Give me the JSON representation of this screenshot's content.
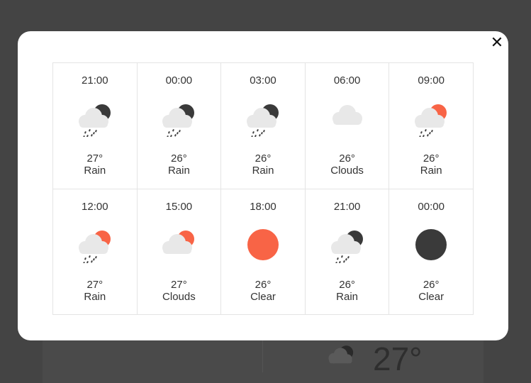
{
  "modal": {
    "close_label": "✕"
  },
  "background": {
    "temperature": "27°",
    "icon": "rain-night-icon"
  },
  "forecast": [
    {
      "time": "21:00",
      "temp": "27°",
      "condition": "Rain",
      "icon": "rain-night"
    },
    {
      "time": "00:00",
      "temp": "26°",
      "condition": "Rain",
      "icon": "rain-night"
    },
    {
      "time": "03:00",
      "temp": "26°",
      "condition": "Rain",
      "icon": "rain-night"
    },
    {
      "time": "06:00",
      "temp": "26°",
      "condition": "Clouds",
      "icon": "clouds"
    },
    {
      "time": "09:00",
      "temp": "26°",
      "condition": "Rain",
      "icon": "rain-day"
    },
    {
      "time": "12:00",
      "temp": "27°",
      "condition": "Rain",
      "icon": "rain-day"
    },
    {
      "time": "15:00",
      "temp": "27°",
      "condition": "Clouds",
      "icon": "clouds-day"
    },
    {
      "time": "18:00",
      "temp": "26°",
      "condition": "Clear",
      "icon": "clear-day"
    },
    {
      "time": "21:00",
      "temp": "26°",
      "condition": "Rain",
      "icon": "rain-night"
    },
    {
      "time": "00:00",
      "temp": "26°",
      "condition": "Clear",
      "icon": "clear-night"
    }
  ],
  "colors": {
    "sun": "#f86446",
    "moon": "#3a3a3a",
    "cloud": "#e8e8e8",
    "rain": "#444444",
    "overlay": "#444444"
  }
}
